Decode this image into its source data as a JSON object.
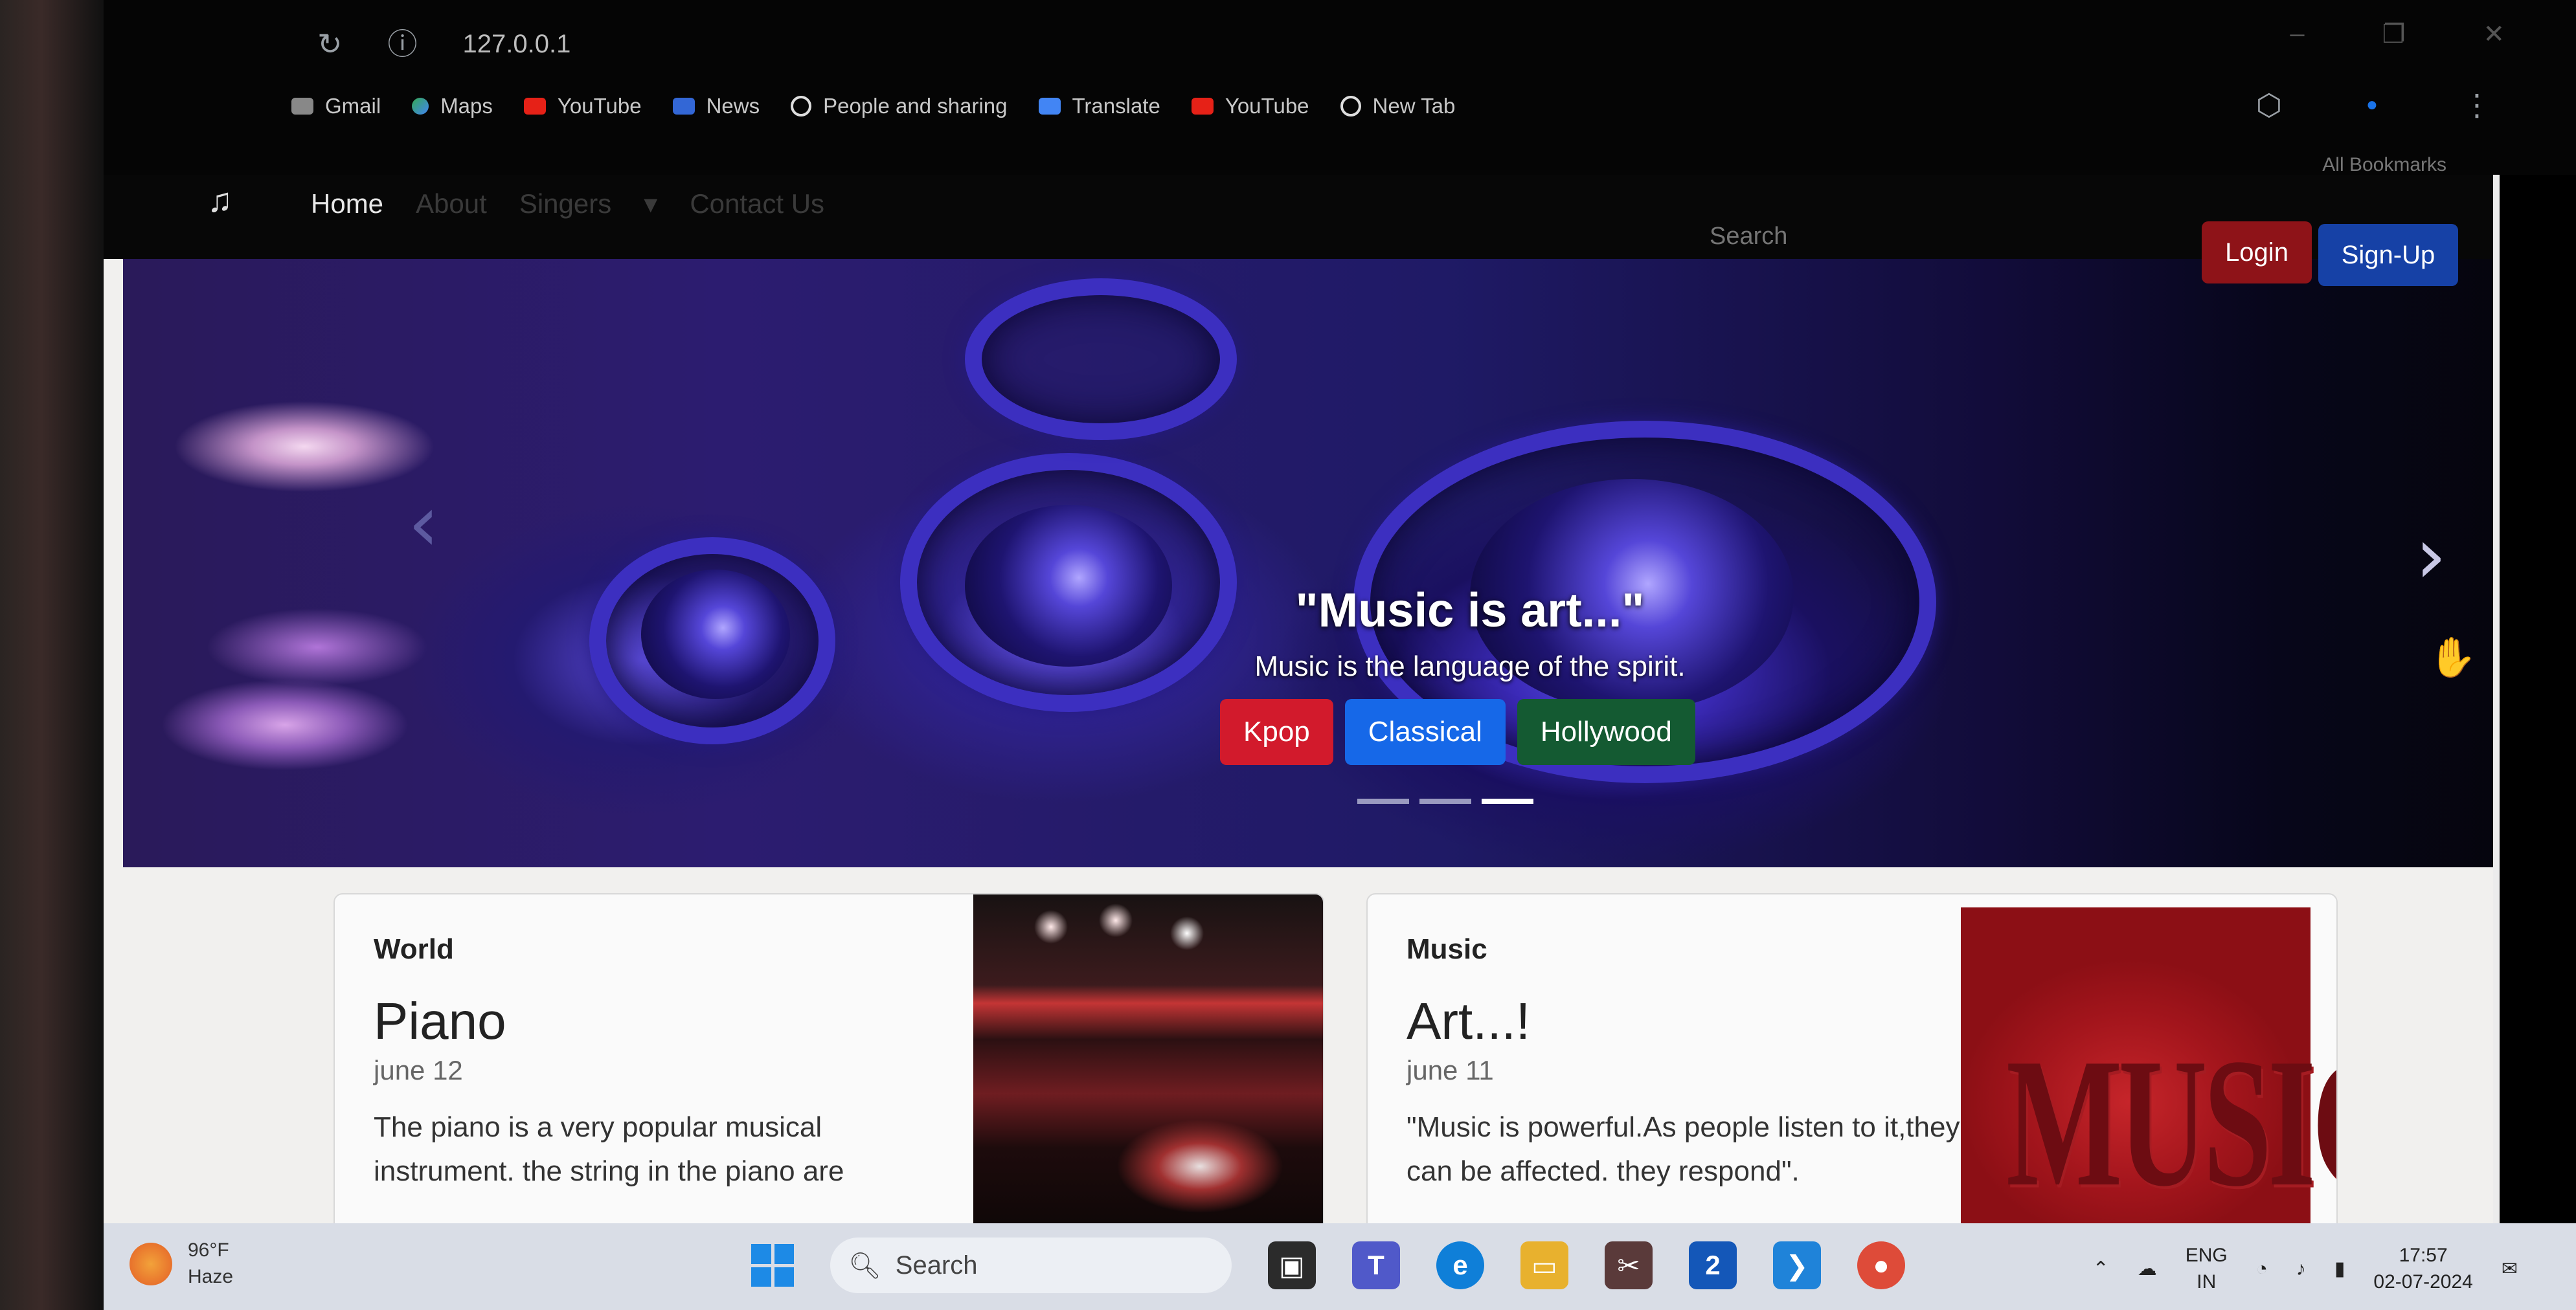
{
  "browser": {
    "url": "127.0.0.1",
    "all_bookmarks": "All Bookmarks",
    "bookmarks": [
      {
        "label": "Gmail",
        "icon": "gmail-icon"
      },
      {
        "label": "Maps",
        "icon": "maps-icon"
      },
      {
        "label": "YouTube",
        "icon": "youtube-icon"
      },
      {
        "label": "News",
        "icon": "news-icon"
      },
      {
        "label": "People and sharing",
        "icon": "google-icon"
      },
      {
        "label": "Translate",
        "icon": "translate-icon"
      },
      {
        "label": "YouTube",
        "icon": "youtube-icon"
      },
      {
        "label": "New Tab",
        "icon": "globe-icon"
      }
    ]
  },
  "navbar": {
    "brand_icon": "music-note-icon",
    "links": [
      "Home",
      "About",
      "Singers",
      "Contact Us"
    ],
    "search_placeholder": "Search",
    "login_label": "Login",
    "signup_label": "Sign-Up"
  },
  "hero": {
    "title": "\"Music is art...\"",
    "subtitle": "Music is the language of the spirit.",
    "buttons": [
      "Kpop",
      "Classical",
      "Hollywood"
    ],
    "prev": "‹",
    "next": "›",
    "slides": 3,
    "active_slide": 3
  },
  "cards": [
    {
      "category": "World",
      "title": "Piano",
      "date": "june 12",
      "text": "The piano is a very popular musical instrument. the string in the piano are"
    },
    {
      "category": "Music",
      "title": "Art...!",
      "date": "june 11",
      "text": "\"Music is powerful.As people listen to it,they can be affected. they respond\".",
      "image_text": "MUSIC"
    }
  ],
  "taskbar": {
    "temperature": "96°F",
    "condition": "Haze",
    "search_label": "Search",
    "lang_top": "ENG",
    "lang_bottom": "IN",
    "time": "17:57",
    "date": "02-07-2024",
    "lens_badge": "2"
  },
  "colors": {
    "kpop": "#d21a2c",
    "classical": "#1668e8",
    "hollywood": "#145a32",
    "login": "#8e1318",
    "signup": "#1641a6"
  }
}
